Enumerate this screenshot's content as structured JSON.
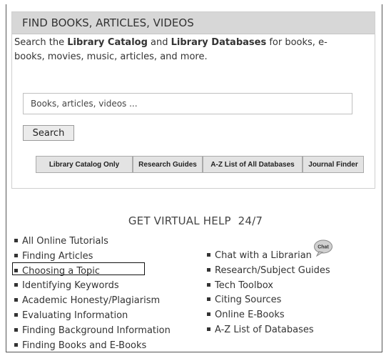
{
  "search_box": {
    "header": "FIND BOOKS, ARTICLES, VIDEOS",
    "intro_prefix": "Search the ",
    "catalog_bold": "Library Catalog",
    "and": " and ",
    "databases_bold": "Library Databases",
    "intro_suffix": " for books, e-books, movies, music, articles, and more.",
    "input_placeholder": "Books, articles, videos ...",
    "search_button": "Search",
    "tabs": [
      "Library Catalog Only",
      "Research Guides",
      "A-Z List of All Databases",
      "Journal Finder"
    ]
  },
  "virtual_help": {
    "heading": "GET VIRTUAL HELP  24/7",
    "left_links": [
      "All Online Tutorials",
      "Finding Articles",
      "Choosing a Topic",
      "Identifying Keywords",
      "Academic Honesty/Plagiarism",
      "Evaluating Information",
      "Finding Background Information",
      "Finding Books and E-Books"
    ],
    "right_links": [
      "Chat with a Librarian",
      "Research/Subject Guides",
      "Tech Toolbox",
      "Citing Sources",
      "Online E-Books",
      "A-Z List of Databases"
    ],
    "chat_icon_text": "Chat",
    "highlighted_item": "Choosing a Topic"
  },
  "colors": {
    "header_bg": "#d7d7d7",
    "tab_bg": "#e3e3e3",
    "highlight_border": "#111111",
    "chat_bubble": "#d0d0d0"
  }
}
